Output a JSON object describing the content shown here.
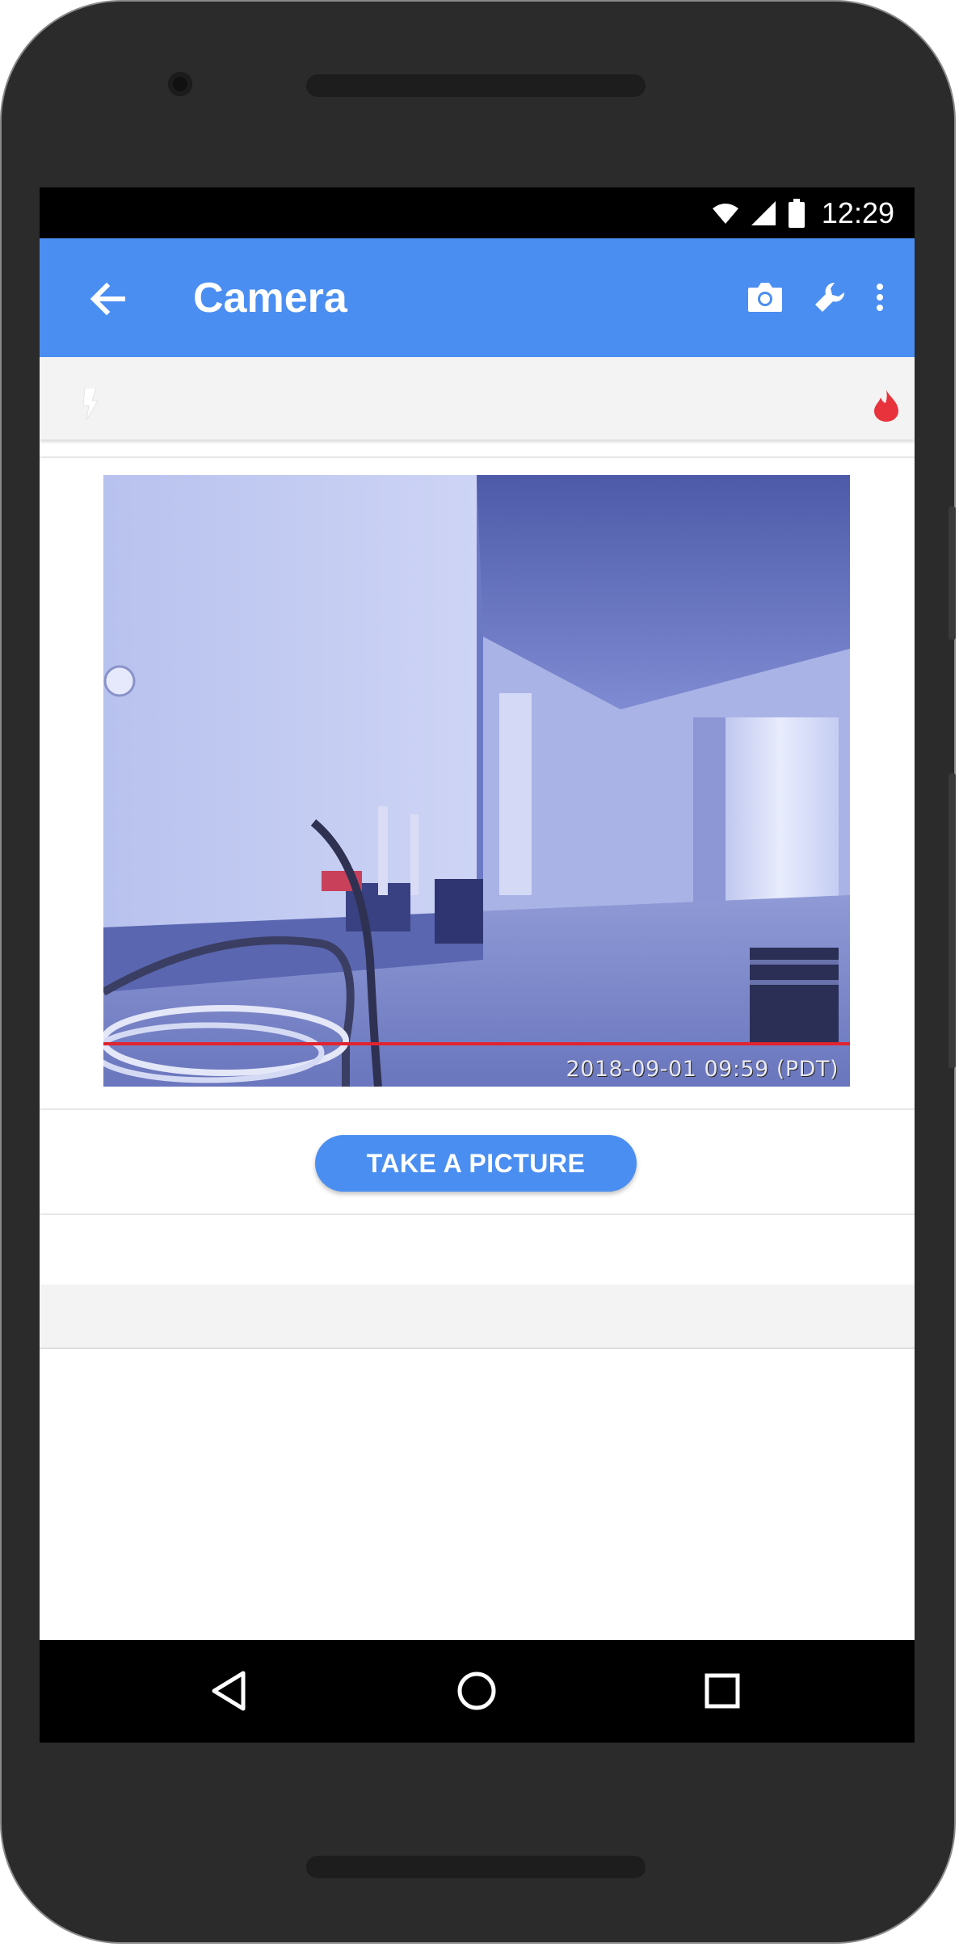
{
  "status_bar": {
    "time": "12:29",
    "icons": [
      "wifi-icon",
      "signal-icon",
      "battery-icon"
    ]
  },
  "app_bar": {
    "title": "Camera",
    "actions": [
      "back-arrow-icon",
      "camera-icon",
      "wrench-icon",
      "more-vert-icon"
    ]
  },
  "sub_bar": {
    "left_icon": "bolt-icon",
    "right_icon": "flame-icon",
    "flame_color": "#e8333c"
  },
  "camera_feed": {
    "timestamp": "2018-09-01 09:59 (PDT)"
  },
  "actions": {
    "take_picture_label": "TAKE A PICTURE"
  },
  "nav_bar": {
    "buttons": [
      "nav-back-icon",
      "nav-home-icon",
      "nav-recents-icon"
    ]
  },
  "colors": {
    "accent": "#4a8ef1",
    "status_bar": "#000000",
    "nav_bar": "#000000"
  }
}
